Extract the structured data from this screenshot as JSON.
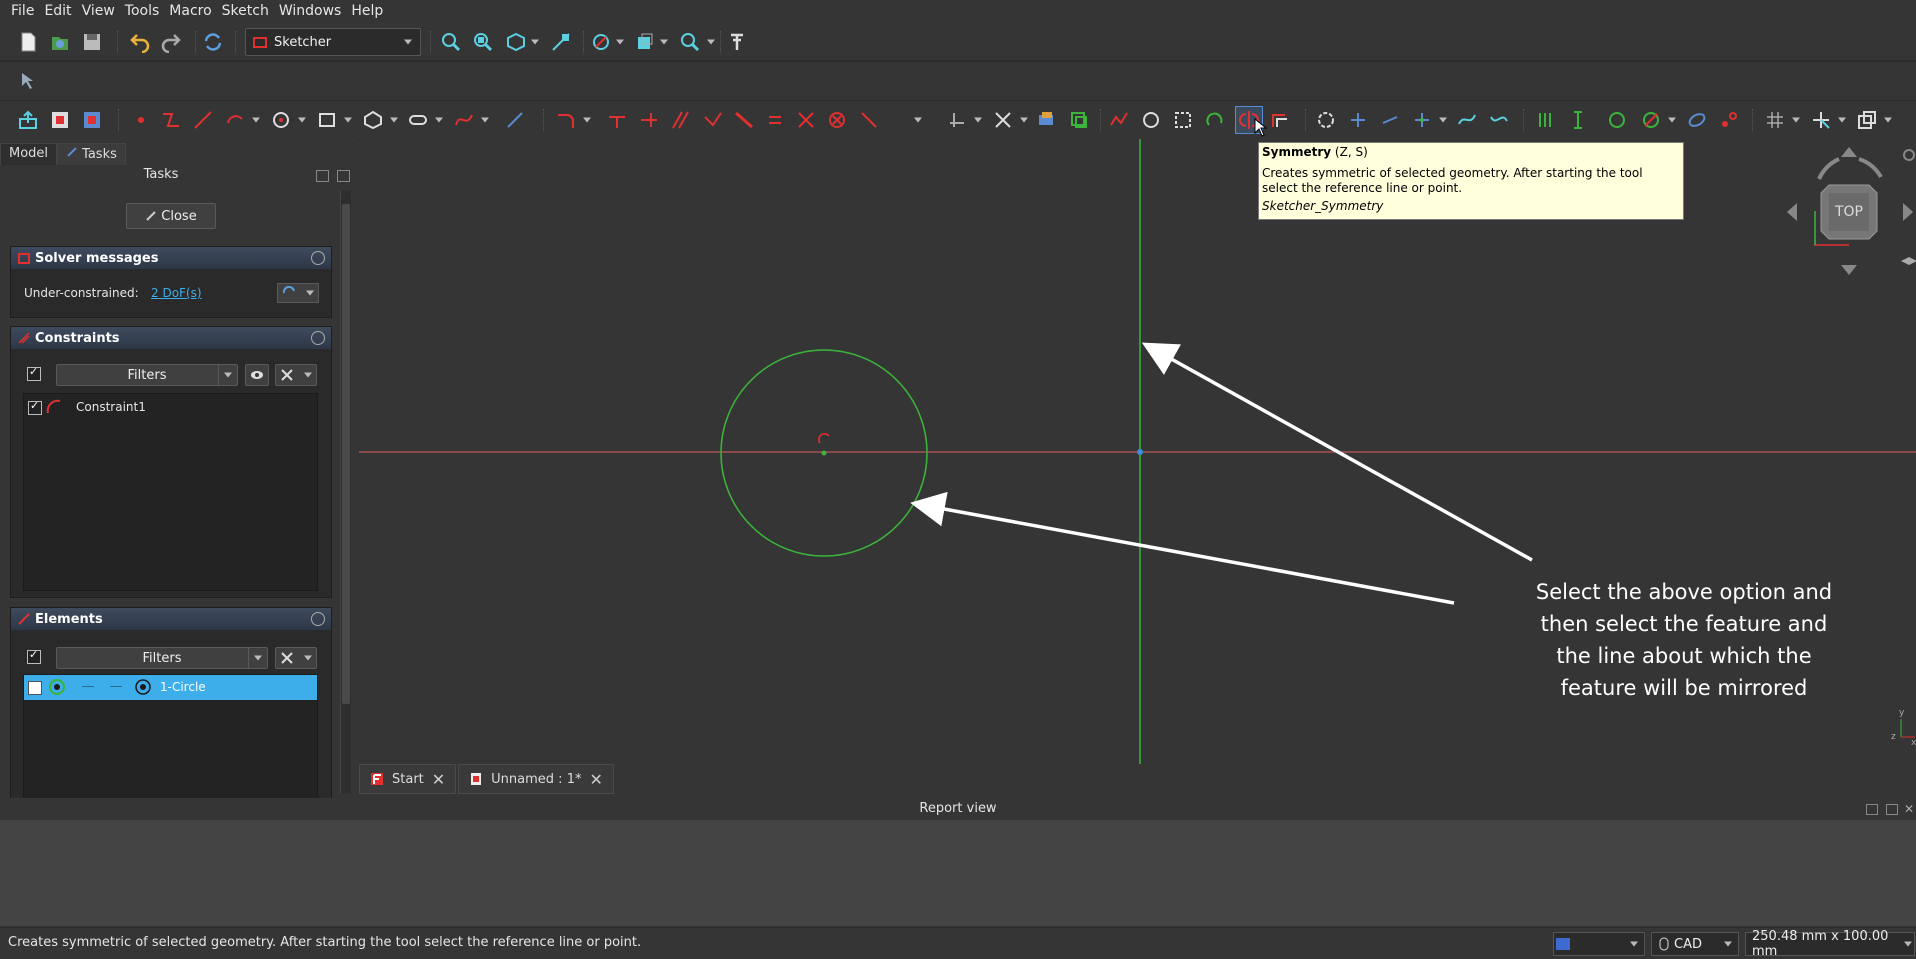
{
  "menu": [
    "File",
    "Edit",
    "View",
    "Tools",
    "Macro",
    "Sketch",
    "Windows",
    "Help"
  ],
  "workbench": {
    "selected": "Sketcher"
  },
  "panel": {
    "tabs": [
      "Model",
      "Tasks"
    ],
    "title": "Tasks",
    "close_label": "Close",
    "solver": {
      "title": "Solver messages",
      "status_label": "Under-constrained:",
      "dof_link": "2 DoF(s)"
    },
    "constraints": {
      "title": "Constraints",
      "filter_label": "Filters",
      "items": [
        "Constraint1"
      ]
    },
    "elements": {
      "title": "Elements",
      "filter_label": "Filters",
      "items": [
        "1-Circle"
      ]
    }
  },
  "tooltip": {
    "title": "Symmetry",
    "shortcut": "(Z, S)",
    "description": "Creates symmetric of selected geometry. After starting the tool select the reference line or point.",
    "command": "Sketcher_Symmetry"
  },
  "navcube": {
    "face_label": "TOP"
  },
  "annotation": {
    "lines": [
      "Select the above option and",
      "then select the feature and",
      "the line about which the",
      "feature will be mirrored"
    ]
  },
  "doc_tabs": [
    "Start",
    "Unnamed : 1*"
  ],
  "report": {
    "title": "Report view"
  },
  "status": {
    "message": "Creates symmetric of selected geometry. After starting the tool select the reference line or point.",
    "nav_style": "CAD",
    "dimensions": "250.48 mm x 100.00 mm"
  },
  "colors": {
    "accent": "#3daee9",
    "tooltip_bg": "#ffffdc",
    "axis_h": "#e06060",
    "axis_v": "#3cb43c",
    "geometry": "#3cb43c"
  }
}
